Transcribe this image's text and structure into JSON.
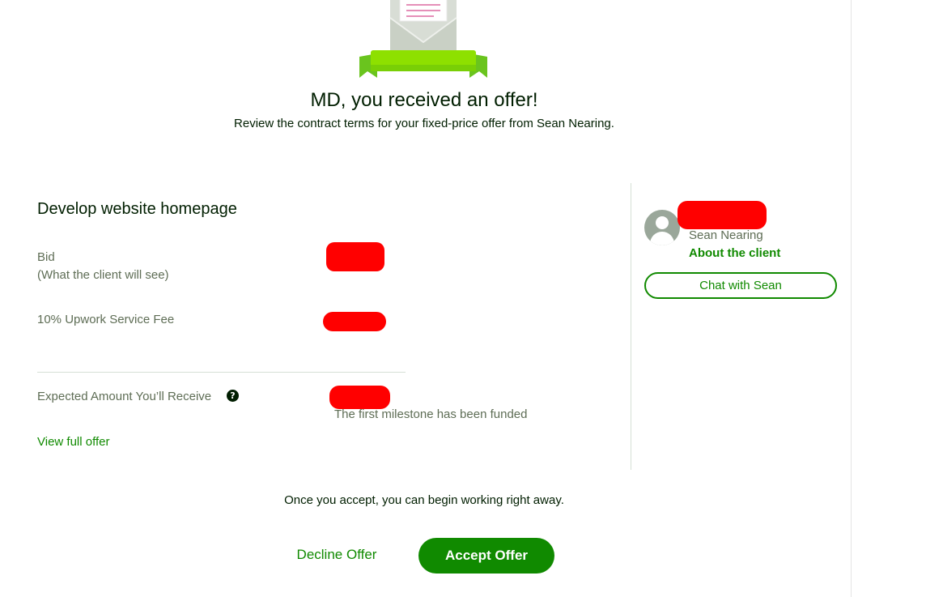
{
  "header": {
    "title": "MD, you received an offer!",
    "subtitle": "Review the contract terms for your fixed-price offer from Sean Nearing."
  },
  "offer": {
    "job_title": "Develop website homepage",
    "bid_label": "Bid",
    "bid_sublabel": "(What the client will see)",
    "fee_label": "10% Upwork Service Fee",
    "expected_label": "Expected Amount You’ll Receive",
    "help_icon": "question-circle-icon",
    "funded_note": "The first milestone has been funded",
    "view_full_offer": "View full offer"
  },
  "client": {
    "avatar_icon": "user-avatar-icon",
    "name": "Sean Nearing",
    "about_link": "About the client",
    "chat_button": "Chat with Sean"
  },
  "footer": {
    "note": "Once you accept, you can begin working right away.",
    "decline_label": "Decline Offer",
    "accept_label": "Accept Offer"
  },
  "colors": {
    "brand_green": "#108a00",
    "redaction": "#ff0000",
    "text_dark": "#001e00",
    "text_muted": "#5e6d55"
  }
}
